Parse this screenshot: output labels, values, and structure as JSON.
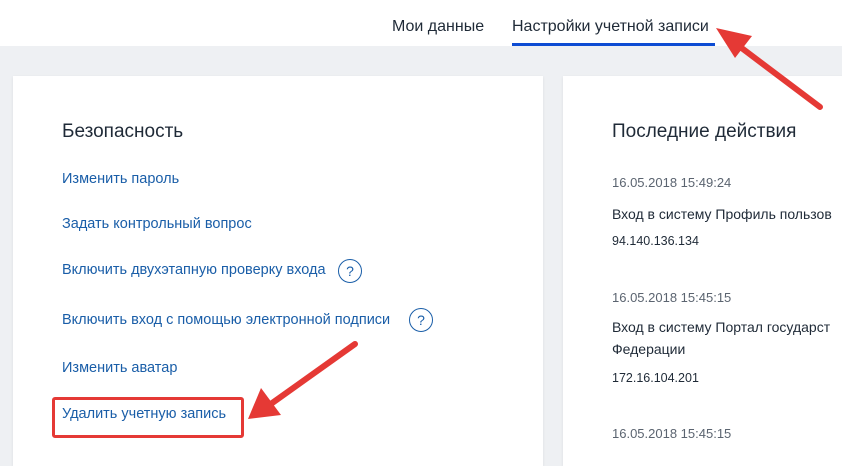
{
  "nav": {
    "tabs": [
      {
        "label": "Мои данные",
        "active": false
      },
      {
        "label": "Настройки учетной записи",
        "active": true
      }
    ],
    "active_color": "#0d4cd3"
  },
  "security": {
    "title": "Безопасность",
    "links": [
      {
        "label": "Изменить пароль",
        "help": false
      },
      {
        "label": "Задать контрольный вопрос",
        "help": false
      },
      {
        "label": "Включить двухэтапную проверку входа",
        "help": true
      },
      {
        "label": "Включить вход с помощью электронной подписи",
        "help": true
      },
      {
        "label": "Изменить аватар",
        "help": false
      },
      {
        "label": "Удалить учетную запись",
        "help": false
      }
    ],
    "help_glyph": "?",
    "link_color": "#1a5ea8"
  },
  "recent": {
    "title": "Последние действия",
    "events": [
      {
        "timestamp": "16.05.2018 15:49:24",
        "line1": "Вход в систему Профиль пользов",
        "ip": "94.140.136.134"
      },
      {
        "timestamp": "16.05.2018 15:45:15",
        "line1": "Вход в систему Портал государст",
        "line2": "Федерации",
        "ip": "172.16.104.201"
      },
      {
        "timestamp": "16.05.2018 15:45:15"
      }
    ]
  },
  "annotation": {
    "color": "#e53935"
  }
}
